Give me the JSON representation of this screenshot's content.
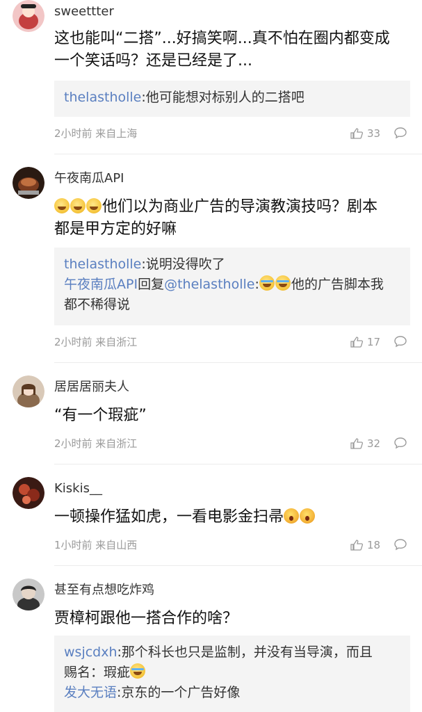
{
  "comments": [
    {
      "username": "sweettter",
      "text_lines": [
        "这也能叫“二搭”...好搞笑啊...真不怕在圈内都变成",
        "一个笑话吗？还是已经是了..."
      ],
      "replies": [
        {
          "segments": [
            {
              "t": "thelastholle",
              "link": true
            },
            {
              "t": ":他可能想对标别人的二搭吧",
              "link": false
            }
          ]
        }
      ],
      "meta": "2小时前 来自上海",
      "likes": "33",
      "avatar_colors": [
        "#f2c6c6",
        "#c44040"
      ]
    },
    {
      "username": "午夜南瓜API",
      "text_prefix_emojis": [
        "smile-emoji",
        "smile-emoji",
        "smile-emoji"
      ],
      "text_lines": [
        "他们以为商业广告的导演教演技吗？剧本",
        "都是甲方定的好嘛"
      ],
      "replies": [
        {
          "segments": [
            {
              "t": "thelastholle",
              "link": true
            },
            {
              "t": ":说明没得吹了",
              "link": false
            }
          ]
        },
        {
          "segments": [
            {
              "t": "午夜南瓜API",
              "link": true
            },
            {
              "t": "回复",
              "link": false
            },
            {
              "t": "@thelastholle",
              "link": true
            },
            {
              "t": ":",
              "link": false
            },
            {
              "emoji": "cry"
            },
            {
              "emoji": "cry"
            },
            {
              "t": "他的广告脚本我",
              "link": false
            }
          ]
        },
        {
          "segments": [
            {
              "t": "都不稀得说",
              "link": false
            }
          ]
        }
      ],
      "meta": "2小时前 来自浙江",
      "likes": "17",
      "avatar_colors": [
        "#6b3a22",
        "#2a1a12"
      ]
    },
    {
      "username": "居居居丽夫人",
      "text_lines": [
        "“有一个瑕疵”"
      ],
      "replies": [],
      "meta": "2小时前 来自浙江",
      "likes": "32",
      "avatar_colors": [
        "#d9c9b8",
        "#7a5a3e"
      ]
    },
    {
      "username": "Kiskis__",
      "text_lines": [
        "一顿操作猛如虎，一看电影金扫帚"
      ],
      "text_suffix_emojis": [
        "shock",
        "shock"
      ],
      "replies": [],
      "meta": "1小时前 来自山西",
      "likes": "18",
      "avatar_colors": [
        "#b03a2a",
        "#3a1a14"
      ]
    },
    {
      "username": "甚至有点想吃炸鸡",
      "text_lines": [
        "贾樟柯跟他一搭合作的啥？"
      ],
      "replies": [
        {
          "segments": [
            {
              "t": "wsjcdxh",
              "link": true
            },
            {
              "t": ":那个科长也只是监制，并没有当导演，而且",
              "link": false
            }
          ]
        },
        {
          "segments": [
            {
              "t": "赐名：瑕疵",
              "link": false
            },
            {
              "emoji": "cry"
            }
          ]
        },
        {
          "segments": [
            {
              "t": "发大无语",
              "link": true
            },
            {
              "t": ":京东的一个广告好像",
              "link": false
            }
          ]
        }
      ],
      "meta": "",
      "likes": "",
      "avatar_colors": [
        "#c8c8c8",
        "#4a4a4a"
      ]
    }
  ],
  "colors": {
    "link": "#5a7fc0",
    "meta": "#9a9a9a",
    "reply_bg": "#f4f4f4"
  }
}
